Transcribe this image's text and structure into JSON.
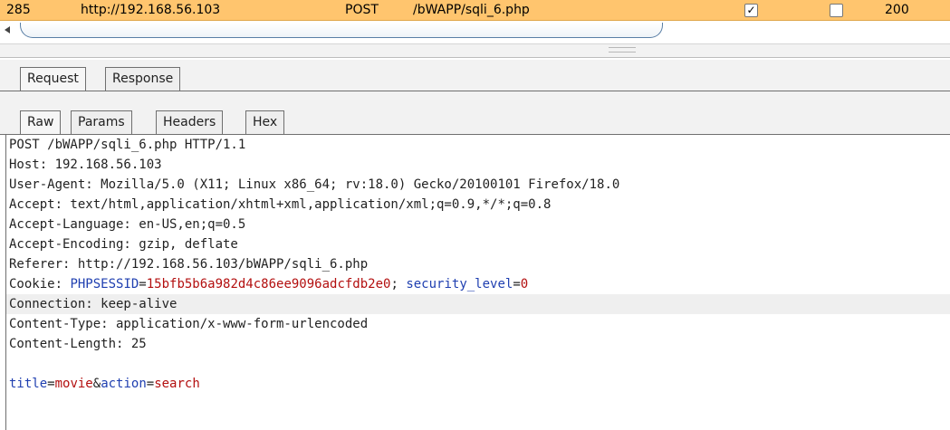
{
  "history_row": {
    "id": "285",
    "host": "http://192.168.56.103",
    "method": "POST",
    "url": "/bWAPP/sqli_6.php",
    "params_checked": true,
    "edited_checked": false,
    "status": "200"
  },
  "tabs_outer": [
    "Request",
    "Response"
  ],
  "tabs_inner": [
    "Raw",
    "Params",
    "Headers",
    "Hex"
  ],
  "request": {
    "request_line": "POST /bWAPP/sqli_6.php HTTP/1.1",
    "host": "Host: 192.168.56.103",
    "user_agent": "User-Agent: Mozilla/5.0 (X11; Linux x86_64; rv:18.0) Gecko/20100101 Firefox/18.0",
    "accept": "Accept: text/html,application/xhtml+xml,application/xml;q=0.9,*/*;q=0.8",
    "accept_language": "Accept-Language: en-US,en;q=0.5",
    "accept_encoding": "Accept-Encoding: gzip, deflate",
    "referer": "Referer: http://192.168.56.103/bWAPP/sqli_6.php",
    "cookie": {
      "label": "Cookie: ",
      "name1": "PHPSESSID",
      "eq1": "=",
      "value1": "15bfb5b6a982d4c86ee9096adcfdb2e0",
      "sep": "; ",
      "name2": "security_level",
      "eq2": "=",
      "value2": "0"
    },
    "connection": "Connection: keep-alive",
    "content_type": "Content-Type: application/x-www-form-urlencoded",
    "content_length": "Content-Length: 25",
    "body": {
      "p1": "title",
      "eq1": "=",
      "v1": "movie",
      "amp": "&",
      "p2": "action",
      "eq2": "=",
      "v2": "search"
    }
  },
  "colors": {
    "row_highlight": "#ffc56e",
    "param_name": "#1f3fb0",
    "param_value": "#b30f0f",
    "line_highlight": "#efefef"
  }
}
